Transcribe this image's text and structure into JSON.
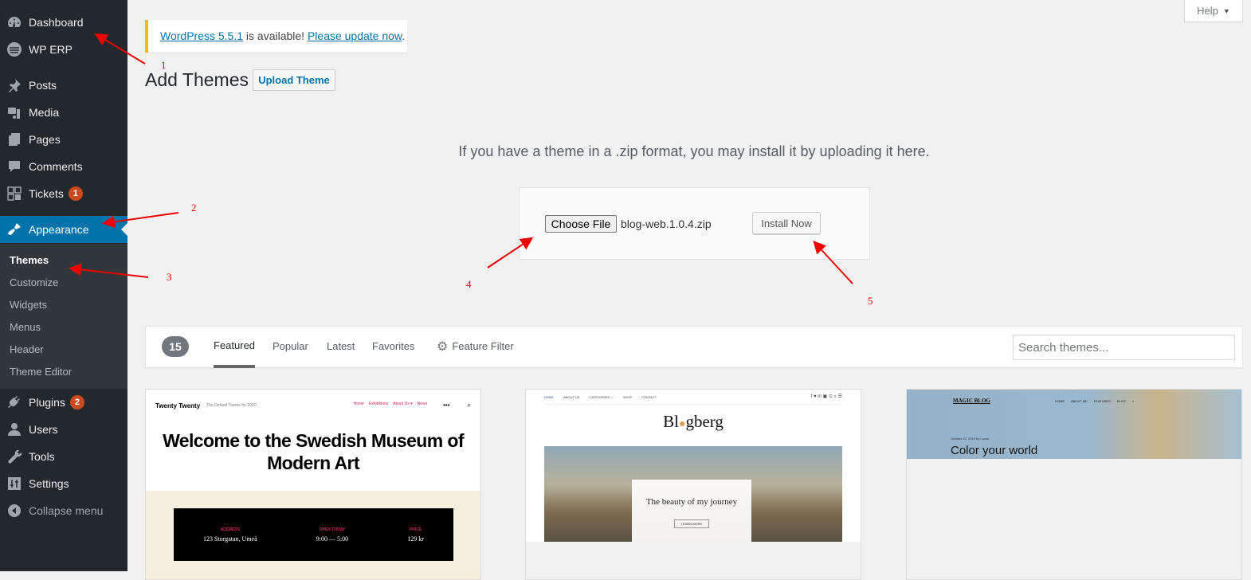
{
  "sidebar": {
    "items": [
      {
        "label": "Dashboard",
        "icon": "dashboard-icon"
      },
      {
        "label": "WP ERP",
        "icon": "wp-erp-icon"
      },
      {
        "label": "Posts",
        "icon": "pin-icon"
      },
      {
        "label": "Media",
        "icon": "media-icon"
      },
      {
        "label": "Pages",
        "icon": "pages-icon"
      },
      {
        "label": "Comments",
        "icon": "comment-icon"
      },
      {
        "label": "Tickets",
        "icon": "tickets-icon",
        "badge": "1"
      },
      {
        "label": "Appearance",
        "icon": "paintbrush-icon",
        "active": true
      },
      {
        "label": "Plugins",
        "icon": "plugin-icon",
        "badge": "2"
      },
      {
        "label": "Users",
        "icon": "user-icon"
      },
      {
        "label": "Tools",
        "icon": "wrench-icon"
      },
      {
        "label": "Settings",
        "icon": "settings-icon"
      },
      {
        "label": "Collapse menu",
        "icon": "collapse-icon"
      }
    ],
    "submenu": [
      "Themes",
      "Customize",
      "Widgets",
      "Menus",
      "Header",
      "Theme Editor"
    ],
    "submenu_current": "Themes"
  },
  "notice": {
    "link1": "WordPress 5.5.1",
    "middle": " is available! ",
    "link2": "Please update now",
    "end": "."
  },
  "help": {
    "label": "Help",
    "caret": "▼"
  },
  "page": {
    "title": "Add Themes",
    "upload_button": "Upload Theme",
    "upload_help": "If you have a theme in a .zip format, you may install it by uploading it here.",
    "choose_file": "Choose File",
    "file_name": "blog-web.1.0.4.zip",
    "install_now": "Install Now"
  },
  "filter": {
    "count": "15",
    "tabs": [
      "Featured",
      "Popular",
      "Latest",
      "Favorites"
    ],
    "current_tab": "Featured",
    "feature_filter": "Feature Filter",
    "search_placeholder": "Search themes..."
  },
  "themes": [
    {
      "name": "Twenty Twenty",
      "preview": {
        "site": "Twenty Twenty",
        "tagline": "The Default Theme for 2020",
        "nav": [
          "Home",
          "Exhibitions",
          "About Us ▾",
          "News"
        ],
        "heading": "Welcome to the Swedish Museum of Modern Art",
        "info": [
          {
            "label": "ADDRESS",
            "value": "123 Storgatan, Umeå"
          },
          {
            "label": "OPEN TODAY",
            "value": "9:00 — 5:00"
          },
          {
            "label": "PRICE",
            "value": "129 kr"
          }
        ]
      }
    },
    {
      "name": "Blogberg",
      "preview": {
        "nav": [
          "HOME",
          "ABOUT US",
          "CATEGORIES ⌄",
          "SHOP",
          "CONTACT"
        ],
        "logo_a": "Bl",
        "logo_dot": "●",
        "logo_b": "gberg",
        "post_title": "The beauty of my journey",
        "button": "LEARN MORE"
      }
    },
    {
      "name": "Magic Blog",
      "preview": {
        "logo": "MAGIC BLOG",
        "nav": [
          "HOME",
          "ABOUT ME",
          "FEATURES",
          "BLOG",
          "⌕"
        ],
        "date": "October 22, 2019 by Lucas",
        "title": "Color your world"
      }
    }
  ],
  "annotations": [
    "1",
    "2",
    "3",
    "4",
    "5"
  ]
}
